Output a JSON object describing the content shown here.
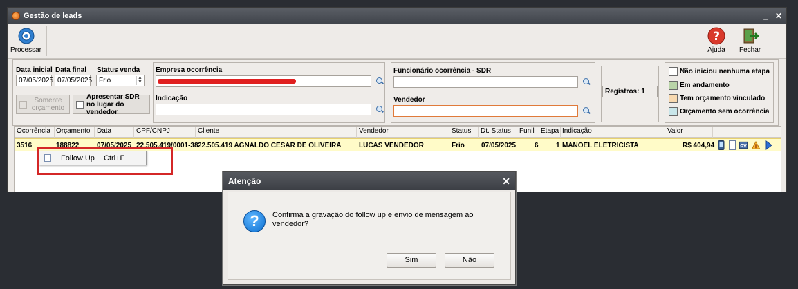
{
  "window": {
    "title": "Gestão de leads",
    "min": "_",
    "close": "✕"
  },
  "toolbar": {
    "processar": "Processar",
    "ajuda": "Ajuda",
    "fechar": "Fechar"
  },
  "filters": {
    "data_inicial_label": "Data inicial",
    "data_inicial": "07/05/2025",
    "data_final_label": "Data final",
    "data_final": "07/05/2025",
    "status_venda_label": "Status venda",
    "status_venda": "Frio",
    "somente_orcamento": "Somente orçamento",
    "apresentar_sdr": "Apresentar SDR no lugar do vendedor",
    "empresa_label": "Empresa ocorrência",
    "indicacao_label": "Indicação",
    "funcionario_label": "Funcionário ocorrência - SDR",
    "vendedor_label": "Vendedor",
    "registros": "Registros: 1"
  },
  "legend": [
    {
      "label": "Não iniciou nenhuma etapa",
      "color": "#ffffff"
    },
    {
      "label": "Em andamento",
      "color": "#b9d4a8"
    },
    {
      "label": "Tem orçamento vinculado",
      "color": "#f8d9b0"
    },
    {
      "label": "Orçamento sem ocorrência",
      "color": "#c9e6ea"
    }
  ],
  "grid": {
    "headers": [
      "Ocorrência",
      "Orçamento",
      "Data",
      "CPF/CNPJ",
      "Cliente",
      "Vendedor",
      "Status",
      "Dt. Status",
      "Funil",
      "Etapa",
      "Indicação",
      "Valor"
    ],
    "row": {
      "ocorrencia": "3516",
      "orcamento": "188822",
      "data": "07/05/2025",
      "cpf": "22.505.419/0001-38",
      "cliente": "22.505.419 AGNALDO CESAR DE OLIVEIRA",
      "vendedor": "LUCAS VENDEDOR",
      "status": "Frio",
      "dt_status": "07/05/2025",
      "funil": "6",
      "etapa": "1",
      "indicacao": "MANOEL ELETRICISTA",
      "valor": "R$ 404,94"
    }
  },
  "context_menu": {
    "label": "Follow Up",
    "shortcut": "Ctrl+F"
  },
  "dialog": {
    "title": "Atenção",
    "close": "✕",
    "message": "Confirma a gravação do follow up e envio de mensagem ao vendedor?",
    "yes": "Sim",
    "no": "Não"
  }
}
